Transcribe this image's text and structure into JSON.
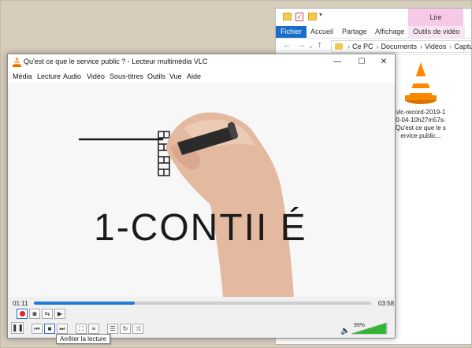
{
  "explorer": {
    "ribbon_context_group": "Lire",
    "tabs": [
      "Fichier",
      "Accueil",
      "Partage",
      "Affichage",
      "Outils de vidéo"
    ],
    "breadcrumb": [
      "Ce PC",
      "Documents",
      "Vidéos",
      "Captures"
    ],
    "file_name": "vlc-record-2019-10-04-10h27m57s-Qu'est ce que le service public...",
    "file_icon": "vlc-cone-icon"
  },
  "vlc": {
    "title": "Qu'est ce que le service public ? - Lecteur multimédia VLC",
    "menu": [
      "Média",
      "Lecture",
      "Audio",
      "Vidéo",
      "Sous-titres",
      "Outils",
      "Vue",
      "Aide"
    ],
    "video_caption": "1-CONTII  É",
    "time_elapsed": "01:11",
    "time_total": "03:58",
    "progress_fraction": 0.3,
    "volume": "99%",
    "tooltip": "Arrêter la lecture",
    "accent": "#1f7ad6",
    "record_color": "#e0242d"
  }
}
